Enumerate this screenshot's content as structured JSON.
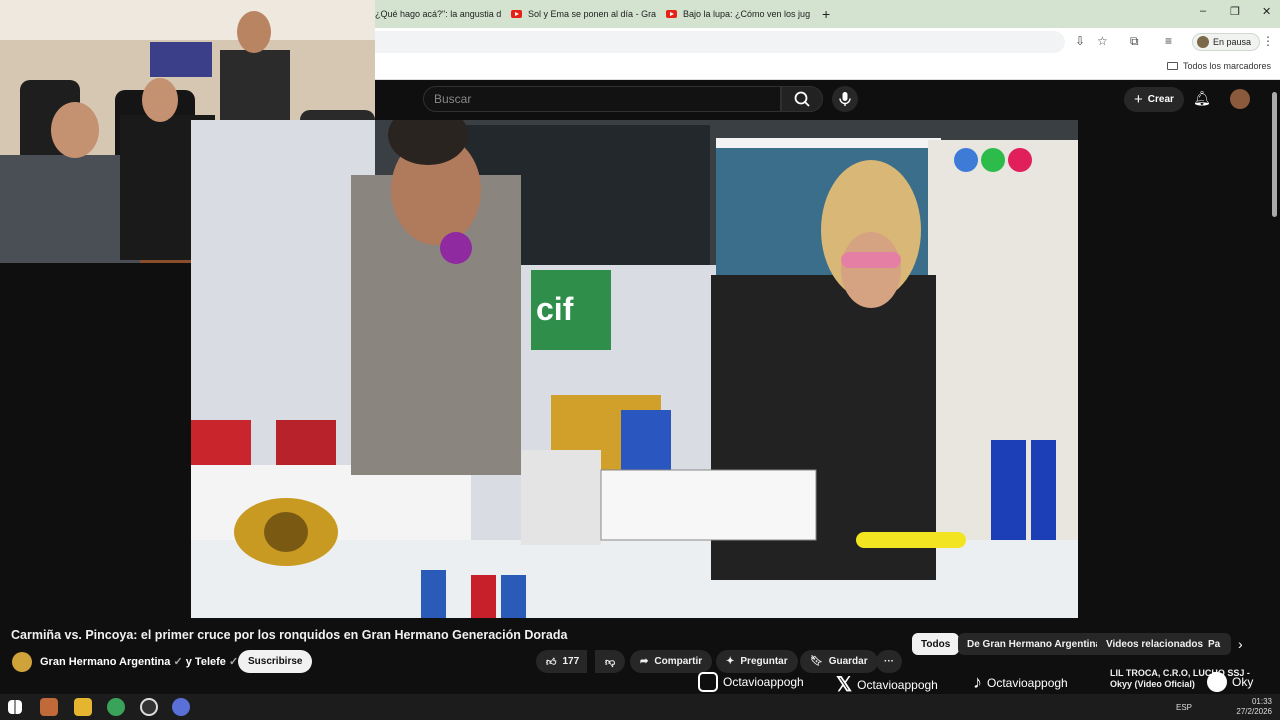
{
  "browser": {
    "tabs": [
      {
        "label": "¿Qué hago acá?\": la angustia d",
        "has_youtube_icon": false
      },
      {
        "label": "Sol y Ema se ponen al día - Gra",
        "has_youtube_icon": true
      },
      {
        "label": "Bajo la lupa: ¿Cómo ven los jug",
        "has_youtube_icon": true
      }
    ],
    "new_tab": "+",
    "profile_status": "En pausa",
    "bookmarks_all": "Todos los marcadores"
  },
  "youtube": {
    "search_placeholder": "Buscar",
    "create_label": "Crear",
    "video_title": "Carmiña vs. Pincoya: el primer cruce por los ronquidos en Gran Hermano Generación Dorada",
    "channel": "Gran Hermano Argentina",
    "collab": "y Telefe",
    "subscribe": "Suscribirse",
    "likes": "177",
    "share": "Compartir",
    "ask": "Preguntar",
    "save": "Guardar",
    "more": "···",
    "chips": [
      "Todos",
      "De Gran Hermano Argentina",
      "Videos relacionados",
      "Pa"
    ],
    "side_snippet_line1": "LIL TROCA, C.R.O, LUCHO SSJ -",
    "side_snippet_line2": "Okyy (Video Oficial)"
  },
  "stream_overlay": {
    "instagram": "Octavioappogh",
    "x": "Octavioappogh",
    "tiktok": "Octavioappogh",
    "spotify": "Oky"
  },
  "taskbar": {
    "lang": "ESP",
    "time": "01:33",
    "date": "27/2/2026"
  },
  "colors": {
    "youtube_red": "#e62117",
    "chrome_tab_bg": "#d3e3d0",
    "yt_bg": "#0f0f0f"
  }
}
